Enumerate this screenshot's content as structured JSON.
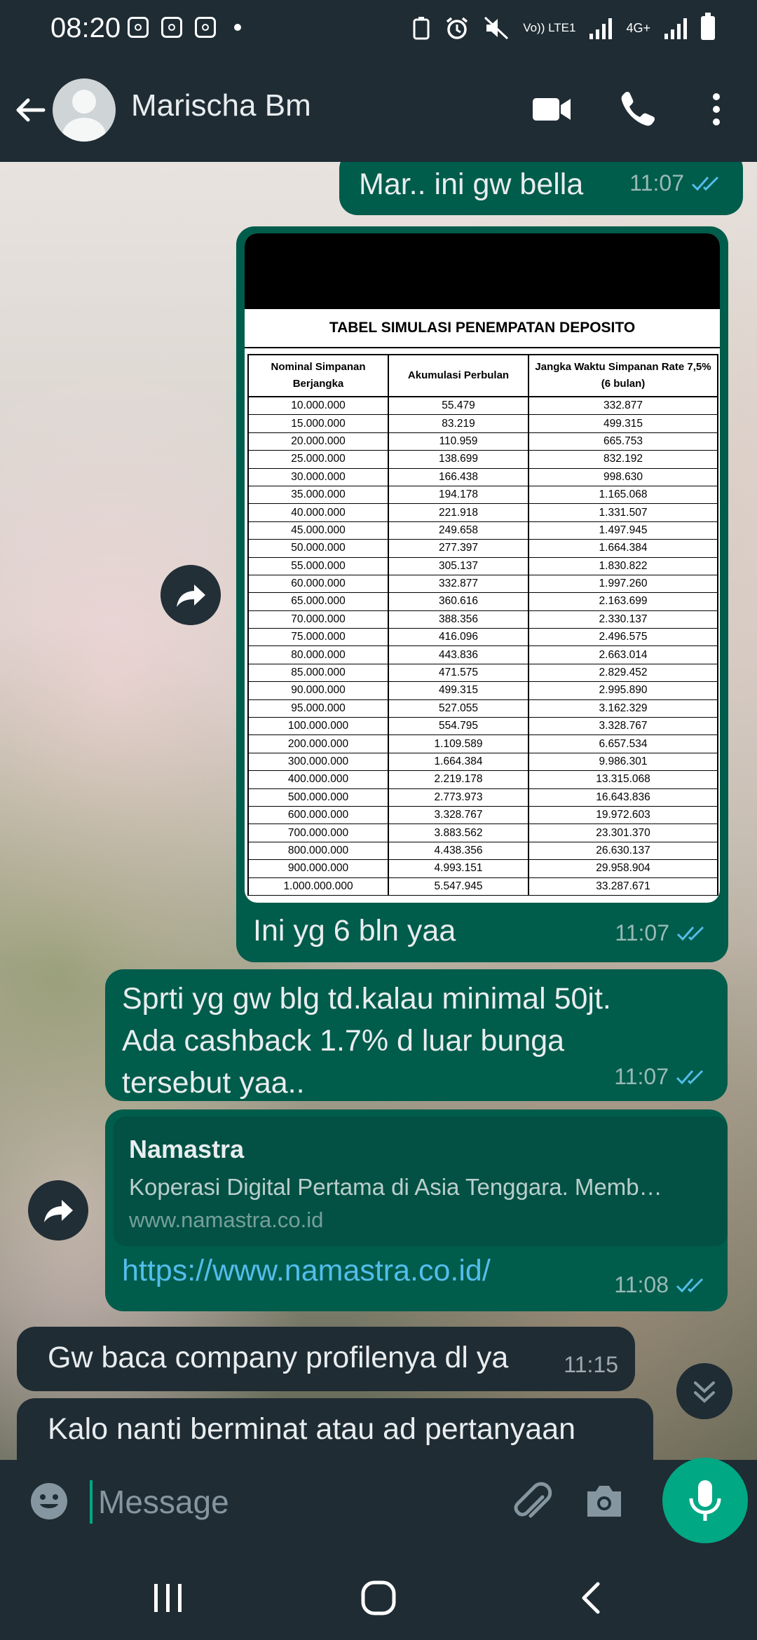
{
  "status_bar": {
    "time": "08:20",
    "network_label": "Vo)) LTE1",
    "network_type": "4G+"
  },
  "header": {
    "contact_name": "Marischa Bm"
  },
  "messages": {
    "m1": {
      "text": "Mar.. ini gw bella",
      "time": "11:07"
    },
    "image_msg": {
      "caption": "Ini yg 6 bln yaa",
      "time": "11:07",
      "table_title": "TABEL SIMULASI PENEMPATAN DEPOSITO",
      "headers": [
        "Nominal Simpanan Berjangka",
        "Akumulasi Perbulan",
        "Jangka Waktu Simpanan Rate 7,5% (6 bulan)"
      ],
      "rows": [
        [
          "10.000.000",
          "55.479",
          "332.877"
        ],
        [
          "15.000.000",
          "83.219",
          "499.315"
        ],
        [
          "20.000.000",
          "110.959",
          "665.753"
        ],
        [
          "25.000.000",
          "138.699",
          "832.192"
        ],
        [
          "30.000.000",
          "166.438",
          "998.630"
        ],
        [
          "35.000.000",
          "194.178",
          "1.165.068"
        ],
        [
          "40.000.000",
          "221.918",
          "1.331.507"
        ],
        [
          "45.000.000",
          "249.658",
          "1.497.945"
        ],
        [
          "50.000.000",
          "277.397",
          "1.664.384"
        ],
        [
          "55.000.000",
          "305.137",
          "1.830.822"
        ],
        [
          "60.000.000",
          "332.877",
          "1.997.260"
        ],
        [
          "65.000.000",
          "360.616",
          "2.163.699"
        ],
        [
          "70.000.000",
          "388.356",
          "2.330.137"
        ],
        [
          "75.000.000",
          "416.096",
          "2.496.575"
        ],
        [
          "80.000.000",
          "443.836",
          "2.663.014"
        ],
        [
          "85.000.000",
          "471.575",
          "2.829.452"
        ],
        [
          "90.000.000",
          "499.315",
          "2.995.890"
        ],
        [
          "95.000.000",
          "527.055",
          "3.162.329"
        ],
        [
          "100.000.000",
          "554.795",
          "3.328.767"
        ],
        [
          "200.000.000",
          "1.109.589",
          "6.657.534"
        ],
        [
          "300.000.000",
          "1.664.384",
          "9.986.301"
        ],
        [
          "400.000.000",
          "2.219.178",
          "13.315.068"
        ],
        [
          "500.000.000",
          "2.773.973",
          "16.643.836"
        ],
        [
          "600.000.000",
          "3.328.767",
          "19.972.603"
        ],
        [
          "700.000.000",
          "3.883.562",
          "23.301.370"
        ],
        [
          "800.000.000",
          "4.438.356",
          "26.630.137"
        ],
        [
          "900.000.000",
          "4.993.151",
          "29.958.904"
        ],
        [
          "1.000.000.000",
          "5.547.945",
          "33.287.671"
        ]
      ]
    },
    "m3": {
      "line1": "Sprti yg gw blg td.kalau minimal 50jt.",
      "line2": "Ada cashback 1.7% d luar bunga",
      "line3": "tersebut yaa..",
      "time": "11:07"
    },
    "m4": {
      "preview_title": "Namastra",
      "preview_desc": "Koperasi Digital Pertama di Asia Tenggara. Memb…",
      "preview_domain": "www.namastra.co.id",
      "url": "https://www.namastra.co.id/",
      "time": "11:08"
    },
    "m5": {
      "text": "Gw baca company profilenya dl ya",
      "time": "11:15"
    },
    "m6": {
      "text": "Kalo nanti berminat atau ad pertanyaan"
    }
  },
  "input": {
    "placeholder": "Message"
  },
  "colors": {
    "outgoing_bubble": "#005c4b",
    "incoming_bubble": "#1f2c34",
    "accent": "#00a884",
    "link": "#53bdeb",
    "read_ticks": "#53bdeb"
  },
  "icons": {
    "back": "back-arrow-icon",
    "video": "video-call-icon",
    "call": "phone-icon",
    "menu": "more-vert-icon",
    "forward": "forward-icon",
    "emoji": "emoji-icon",
    "attach": "attach-icon",
    "camera": "camera-icon",
    "mic": "mic-icon",
    "scroll": "chevron-double-down-icon"
  }
}
